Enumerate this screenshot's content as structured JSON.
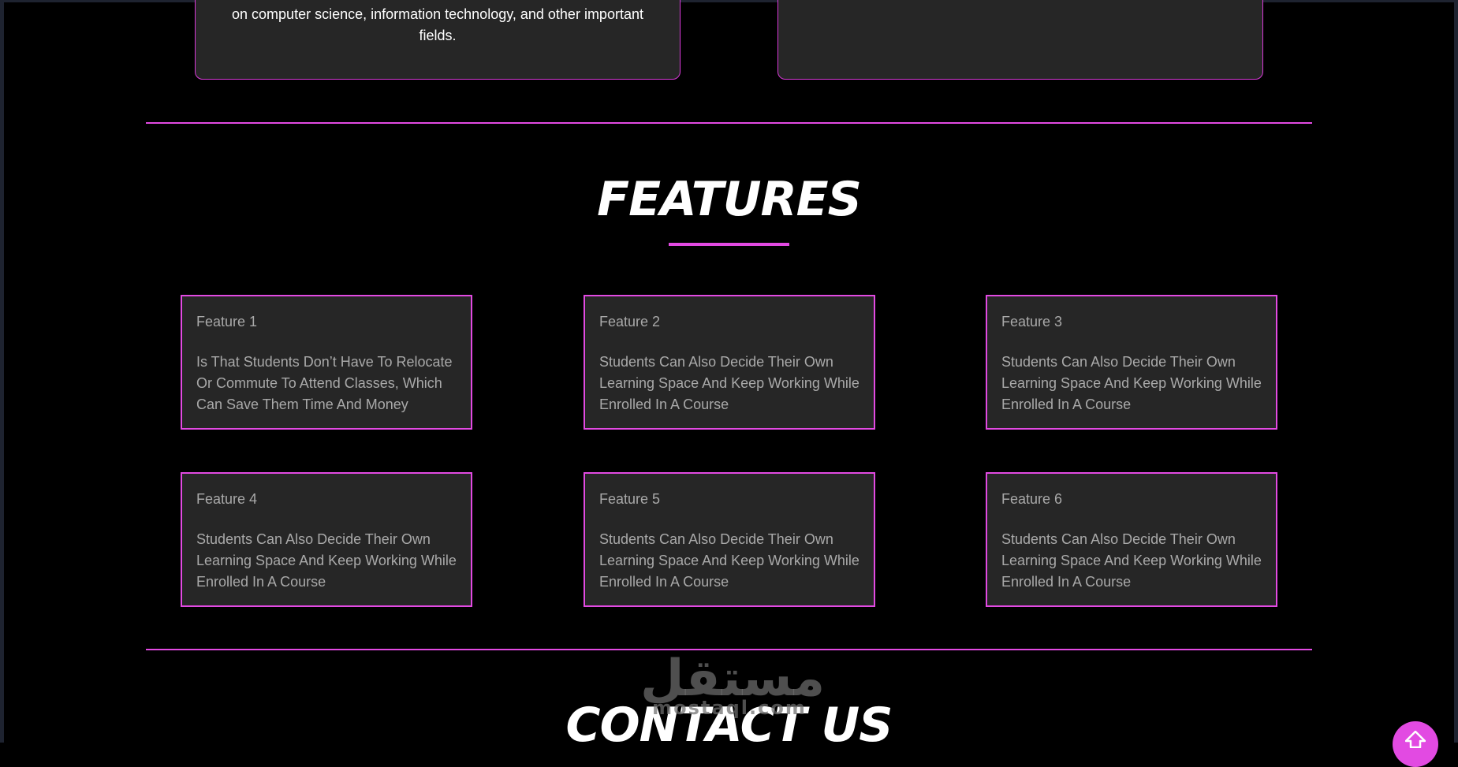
{
  "about": {
    "left_text": "on computer science, information technology, and other important fields.",
    "right_text": ""
  },
  "features": {
    "title": "FEATURES",
    "items": [
      {
        "title": "Feature 1",
        "text": "Is That Students Don’t Have To Relocate Or Commute To Attend Classes, Which Can Save Them Time And Money"
      },
      {
        "title": "Feature 2",
        "text": "Students Can Also Decide Their Own Learning Space And Keep Working While Enrolled In A Course"
      },
      {
        "title": "Feature 3",
        "text": "Students Can Also Decide Their Own Learning Space And Keep Working While Enrolled In A Course"
      },
      {
        "title": "Feature 4",
        "text": "Students Can Also Decide Their Own Learning Space And Keep Working While Enrolled In A Course"
      },
      {
        "title": "Feature 5",
        "text": "Students Can Also Decide Their Own Learning Space And Keep Working While Enrolled In A Course"
      },
      {
        "title": "Feature 6",
        "text": "Students Can Also Decide Their Own Learning Space And Keep Working While Enrolled In A Course"
      }
    ]
  },
  "contact": {
    "title": "CONTACT US"
  },
  "watermark": {
    "arabic": "مستقل",
    "latin": "mostaql.com"
  },
  "scroll_top": {
    "icon": "arrow-up-icon"
  },
  "colors": {
    "accent": "#e24ae2",
    "card_bg": "#262626",
    "page_bg": "#000000",
    "feature_text": "#a9a9a9"
  }
}
